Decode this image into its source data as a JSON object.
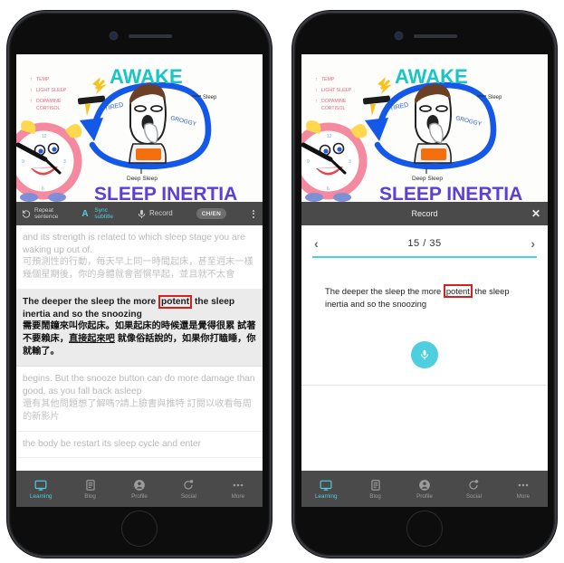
{
  "accent_color": "#4ECFE0",
  "highlight_box_color": "#d81f1f",
  "toolbar_bg": "#4a4a4a",
  "video": {
    "title_main": "SLEEP INERTIA",
    "label_awake": "AWAKE",
    "label_tired": "TIRED",
    "label_groggy": "GROGGY",
    "label_sleep": "Sleep",
    "label_deep_sleep": "Deep Sleep",
    "bullets": [
      "TEMP",
      "LIGHT SLEEP",
      "DOPAMINE",
      "CORTISOL"
    ]
  },
  "toolbar": {
    "repeat_label": "Repeat\nsentence",
    "sync_label": "Sync\nsubtitle",
    "record_label": "Record",
    "lang_toggle": "CH/EN"
  },
  "subtitles": [
    {
      "en": "and its strength is related to which sleep stage you are waking up out of.",
      "zh": "可預測性的行動，每天早上同一時間起床，甚至週末一樣 幾個星期後，你的身體就會習慣早起，並且就不太會",
      "active": false
    },
    {
      "en_before": "The deeper the sleep the more ",
      "en_boxed": "potent",
      "en_after": " the sleep inertia and so the snoozing",
      "zh_before": "需要鬧鐘來叫你起床。如果起床的時候還是覺得很累 試著不要賴床，",
      "zh_underline": "直接起來吧",
      "zh_after": " 就像俗話說的，如果你打瞌睡，你就輸了。",
      "active": true
    },
    {
      "en": "begins.  But the snooze button can do more damage than good, as you fall back asleep",
      "zh": "還有其他問題想了解嗎?請上臉書與推特 訂閱以收看每周的新影片",
      "active": false
    },
    {
      "en": "the body be restart its sleep cycle and enter",
      "zh": "",
      "active": false
    }
  ],
  "record_panel": {
    "title": "Record",
    "close": "✕",
    "prev_arrow": "‹",
    "next_arrow": "›",
    "current_index": "15",
    "separator": "/",
    "total": "35",
    "sentence_before": "The deeper the sleep the more ",
    "sentence_boxed": "potent",
    "sentence_after": " the sleep inertia and so the snoozing"
  },
  "tabs": [
    {
      "label": "Learning",
      "active": true
    },
    {
      "label": "Blog",
      "active": false
    },
    {
      "label": "Profile",
      "active": false
    },
    {
      "label": "Social",
      "active": false
    },
    {
      "label": "More",
      "active": false
    }
  ]
}
